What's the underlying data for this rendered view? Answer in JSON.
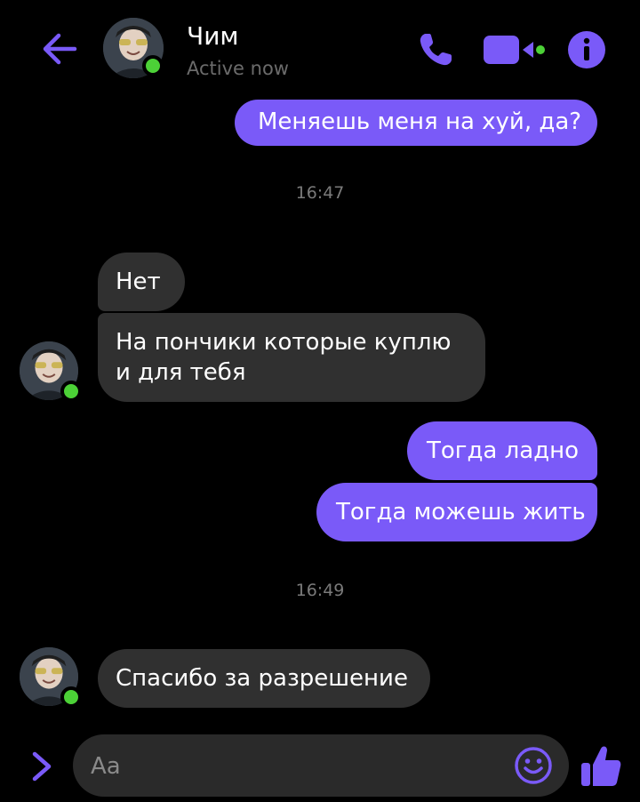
{
  "header": {
    "contact_name": "Чим",
    "status": "Active now"
  },
  "messages": [
    {
      "type": "sent",
      "text": "Меняешь меня на хуй, да?"
    },
    {
      "type": "timestamp",
      "text": "16:47"
    },
    {
      "type": "received",
      "text": "Нет"
    },
    {
      "type": "received",
      "line1": "На пончики которые куплю",
      "line2": "и для тебя"
    },
    {
      "type": "sent",
      "text": "Тогда ладно"
    },
    {
      "type": "sent",
      "text": "Тогда можешь жить"
    },
    {
      "type": "timestamp",
      "text": "16:49"
    },
    {
      "type": "received",
      "text": "Спасибо за разрешение"
    }
  ],
  "composer": {
    "placeholder": "Aa"
  },
  "colors": {
    "accent": "#7a5af8",
    "received_bubble": "#303030",
    "online": "#4cd137",
    "background": "#000000"
  },
  "icons": {
    "back": "arrow-left-icon",
    "call": "phone-icon",
    "video": "video-camera-icon",
    "info": "info-icon",
    "expand": "chevron-right-icon",
    "emoji": "smiley-icon",
    "like": "thumbs-up-icon"
  }
}
